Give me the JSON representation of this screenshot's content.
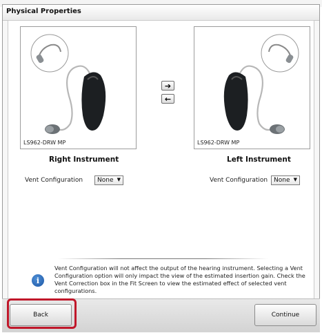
{
  "dialog": {
    "title": "Physical Properties"
  },
  "right_instrument": {
    "model": "LS962-DRW MP",
    "label": "Right Instrument",
    "vent_label": "Vent Configuration",
    "vent_value": "None"
  },
  "left_instrument": {
    "model": "LS962-DRW MP",
    "label": "Left Instrument",
    "vent_label": "Vent Configuration",
    "vent_value": "None"
  },
  "copy_buttons": {
    "to_left": "➔",
    "to_right": "🡐"
  },
  "info": {
    "text": "Vent Configuration will not affect the output of the hearing instrument.  Selecting a Vent Configuration option will only impact the view of the estimated insertion gain. Check the Vent Correction box in the Fit Screen to view the estimated effect of selected vent configurations.",
    "icon": "info-icon"
  },
  "footer": {
    "back_label": "Back",
    "continue_label": "Continue"
  },
  "colors": {
    "highlight": "#c0172a",
    "info_icon": "#1c56a4"
  }
}
